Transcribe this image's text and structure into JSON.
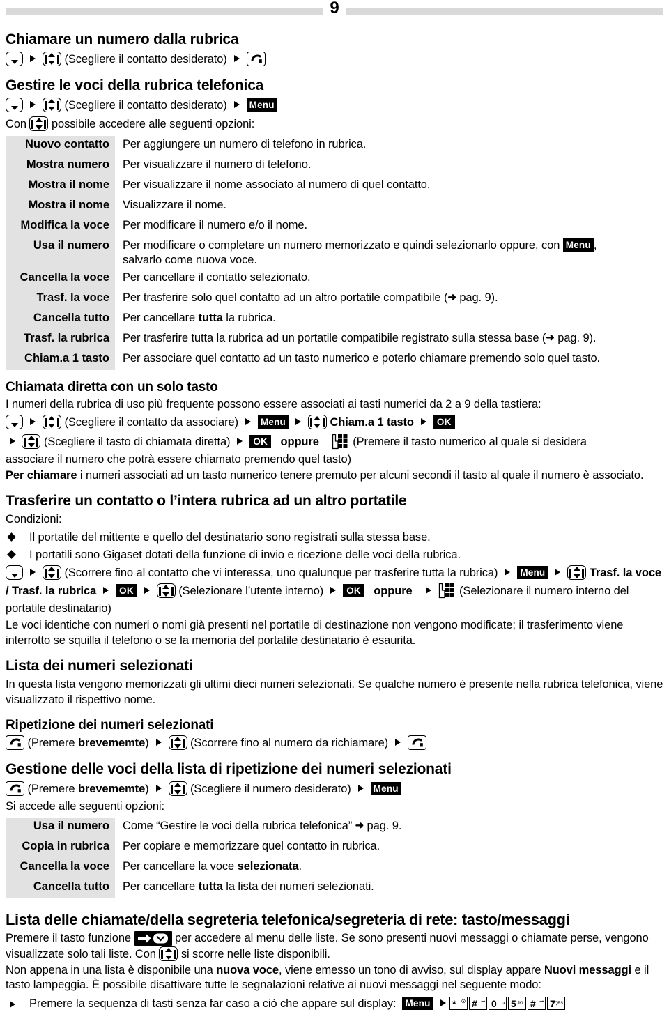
{
  "page": {
    "number": "9"
  },
  "sections": {
    "call_from_directory": {
      "heading": "Chiamare un numero dalla rubrica",
      "step_text": "(Scegliere il contatto desiderato)"
    },
    "manage_directory": {
      "heading": "Gestire le voci della rubrica telefonica",
      "step_text": "(Scegliere il contatto desiderato)",
      "menu_label": "Menu",
      "intro_before": "Con",
      "intro_after": "possibile accedere alle seguenti opzioni:"
    },
    "options_table_1": {
      "rows": [
        {
          "label": "Nuovo contatto",
          "desc": "Per aggiungere un numero di telefono in rubrica."
        },
        {
          "label": "Mostra numero",
          "desc": "Per visualizzare il numero di telefono."
        },
        {
          "label": "Mostra il nome",
          "desc": "Per visualizzare il nome associato al numero di quel contatto."
        },
        {
          "label": "Mostra il nome",
          "desc": "Visualizzare il nome."
        },
        {
          "label": "Modifica la voce",
          "desc": "Per modificare il numero e/o il nome."
        },
        {
          "label": "Usa il numero",
          "desc_a": "Per modificare o completare un numero memorizzato e quindi selezionarlo oppure, con",
          "desc_badge": "Menu",
          "desc_b": ",",
          "desc_c": "salvarlo come nuova voce."
        },
        {
          "label": "Cancella la voce",
          "desc": "Per cancellare il contatto selezionato."
        },
        {
          "label": "Trasf. la voce",
          "desc_a": "Per trasferire solo quel contatto ad un altro portatile compatibile (",
          "desc_ref": "pag. 9",
          "desc_b": ")."
        },
        {
          "label": "Cancella tutto",
          "desc_a": "Per cancellare ",
          "desc_bold": "tutta",
          "desc_b": " la rubrica."
        },
        {
          "label": "Trasf. la rubrica",
          "desc_a": "Per trasferire tutta la rubrica ad un portatile compatibile registrato sulla stessa base (",
          "desc_ref": "pag. 9",
          "desc_b": ")."
        },
        {
          "label": "Chiam.a 1 tasto",
          "desc": "Per associare quel contatto ad un tasto numerico e poterlo chiamare premendo solo quel tasto."
        }
      ]
    },
    "direct_call": {
      "heading": "Chiamata diretta con un solo tasto",
      "intro": "I numeri della rubrica di uso più frequente possono essere associati ai tasti numerici da 2 a 9 della tastiera:",
      "step1_text": "(Scegliere il contatto da associare)",
      "step1_menu": "Menu",
      "step1_item": "Chiam.a 1 tasto",
      "step1_ok": "OK",
      "step2_text": "(Scegliere il tasto di chiamata diretta)",
      "step2_ok": "OK",
      "step2_or": "oppure",
      "step2_tail": "(Premere il tasto numerico al quale si desidera",
      "step2_tail2": "associare il numero che potrà essere chiamato premendo quel tasto)",
      "note_bold": "Per chiamare",
      "note_rest": " i numeri associati ad un tasto numerico tenere premuto per alcuni secondi il tasto al quale il numero è associato."
    },
    "transfer": {
      "heading": "Trasferire un contatto o l’intera rubrica ad un altro portatile",
      "conditions_label": "Condizioni:",
      "conditions": [
        "Il portatile del mittente e quello del destinatario sono registrati sulla stessa base.",
        "I portatili sono Gigaset dotati della funzione di invio e ricezione delle voci della rubrica."
      ],
      "step_text1": "(Scorrere fino al contatto che vi interessa, uno qualunque per trasferire tutta la rubrica)",
      "step_menu": "Menu",
      "step_item": "Trasf. la voce / Trasf. la rubrica",
      "step_ok1": "OK",
      "step_text2": "(Selezionare l’utente interno)",
      "step_ok2": "OK",
      "step_or": "oppure",
      "step_tail": "(Selezionare il numero interno del portatile destinatario)",
      "note": "Le voci identiche con numeri o nomi già presenti nel portatile di destinazione non vengono modificate; il trasferimento viene interrotto se squilla il telefono o se la memoria del portatile destinatario è esaurita."
    },
    "dialed_list": {
      "heading": "Lista dei numeri selezionati",
      "body": "In questa lista vengono memorizzati gli ultimi dieci numeri selezionati. Se qualche numero è presente nella rubrica telefonica, viene visualizzato il rispettivo nome."
    },
    "redial": {
      "heading": "Ripetizione dei numeri selezionati",
      "press_a": "(Premere ",
      "press_bold": "brevememte",
      "press_b": ")",
      "scroll_text": "(Scorrere fino al numero da richiamare)"
    },
    "manage_redial": {
      "heading": "Gestione delle voci della lista di ripetizione dei numeri selezionati",
      "press_a": "(Premere ",
      "press_bold": "brevememte",
      "press_b": ")",
      "choose_text": "(Scegliere il numero desiderato)",
      "menu_label": "Menu",
      "intro": "Si accede alle seguenti opzioni:"
    },
    "options_table_2": {
      "rows": [
        {
          "label": "Usa il numero",
          "desc_a": "Come “Gestire le voci della rubrica telefonica” ",
          "desc_ref": "pag. 9",
          "desc_b": "."
        },
        {
          "label": "Copia in rubrica",
          "desc": "Per copiare e memorizzare quel contatto in rubrica."
        },
        {
          "label": "Cancella la voce",
          "desc_a": "Per cancellare la voce ",
          "desc_bold": "selezionata",
          "desc_b": "."
        },
        {
          "label": "Cancella tutto",
          "desc_a": "Per cancellare ",
          "desc_bold": "tutta",
          "desc_b": " la lista dei numeri selezionati."
        }
      ]
    },
    "call_lists": {
      "heading": "Lista delle chiamate/della segreteria telefonica/segreteria di rete: tasto/messaggi",
      "p1_a": "Premere il tasto funzione",
      "p1_b": "per accedere al menu delle liste. Se sono presenti nuovi messaggi o chiamate perse, vengono visualizzate solo tali liste. Con",
      "p1_c": "si scorre nelle liste disponibili.",
      "p2_a": "Non appena in una lista è disponibile una ",
      "p2_bold1": "nuova voce",
      "p2_b": ", viene emesso un tono di avviso, sul display appare ",
      "p2_bold2": "Nuovi messaggi",
      "p2_c": " e il tasto lampeggia. È possibile disattivare tutte le segnalazioni relative ai nuovi messaggi nel seguente modo:",
      "bullet": "Premere la sequenza di tasti senza far caso a ciò che appare sul display:",
      "menu_label": "Menu",
      "key_sequence": [
        {
          "digit": "*",
          "sub": "bell"
        },
        {
          "digit": "#",
          "sub": "key"
        },
        {
          "digit": "0",
          "sub": "space"
        },
        {
          "digit": "5",
          "sub": "JKL"
        },
        {
          "digit": "#",
          "sub": "key"
        },
        {
          "digit": "7",
          "sub": "PQRS"
        }
      ]
    }
  },
  "colors": {
    "rule": "#d9d9d9",
    "table_label_bg": "#e2e2e2",
    "badge_bg": "#000000",
    "text": "#000000"
  }
}
